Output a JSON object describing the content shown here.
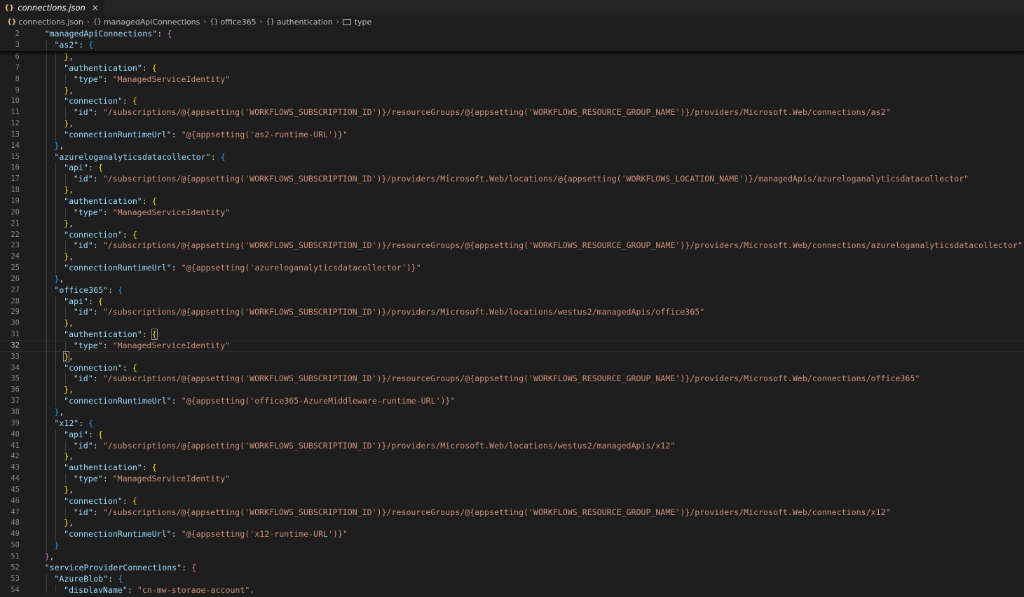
{
  "tab": {
    "icon": "json-braces-icon",
    "icon_text": "{}",
    "label": "connections.json",
    "close": "×"
  },
  "breadcrumb": [
    {
      "icon": "json-braces-icon",
      "icon_text": "{}",
      "label": "connections.json"
    },
    {
      "icon": "object-icon",
      "icon_text": "{}",
      "label": "managedApiConnections"
    },
    {
      "icon": "object-icon",
      "icon_text": "{}",
      "label": "office365"
    },
    {
      "icon": "object-icon",
      "icon_text": "{}",
      "label": "authentication"
    },
    {
      "icon": "string-property-icon",
      "icon_text": "",
      "label": "type"
    }
  ],
  "sticky_lines": [
    {
      "num": "2",
      "indent": 1,
      "tokens": [
        [
          "k",
          "\"managedApiConnections\""
        ],
        [
          "p",
          ": "
        ],
        [
          "b2",
          "{"
        ]
      ]
    },
    {
      "num": "3",
      "indent": 2,
      "tokens": [
        [
          "k",
          "\"as2\""
        ],
        [
          "p",
          ": "
        ],
        [
          "b3",
          "{"
        ]
      ]
    }
  ],
  "current_line": "32",
  "lines": [
    {
      "num": "6",
      "indent": 3,
      "tokens": [
        [
          "b1",
          "}"
        ],
        [
          "p",
          ","
        ]
      ]
    },
    {
      "num": "7",
      "indent": 3,
      "tokens": [
        [
          "k",
          "\"authentication\""
        ],
        [
          "p",
          ": "
        ],
        [
          "b1",
          "{"
        ]
      ]
    },
    {
      "num": "8",
      "indent": 4,
      "tokens": [
        [
          "k",
          "\"type\""
        ],
        [
          "p",
          ": "
        ],
        [
          "s",
          "\"ManagedServiceIdentity\""
        ]
      ]
    },
    {
      "num": "9",
      "indent": 3,
      "tokens": [
        [
          "b1",
          "}"
        ],
        [
          "p",
          ","
        ]
      ]
    },
    {
      "num": "10",
      "indent": 3,
      "tokens": [
        [
          "k",
          "\"connection\""
        ],
        [
          "p",
          ": "
        ],
        [
          "b1",
          "{"
        ]
      ]
    },
    {
      "num": "11",
      "indent": 4,
      "tokens": [
        [
          "k",
          "\"id\""
        ],
        [
          "p",
          ": "
        ],
        [
          "s",
          "\"/subscriptions/@{appsetting('WORKFLOWS_SUBSCRIPTION_ID')}/resourceGroups/@{appsetting('WORKFLOWS_RESOURCE_GROUP_NAME')}/providers/Microsoft.Web/connections/as2\""
        ]
      ]
    },
    {
      "num": "12",
      "indent": 3,
      "tokens": [
        [
          "b1",
          "}"
        ],
        [
          "p",
          ","
        ]
      ]
    },
    {
      "num": "13",
      "indent": 3,
      "tokens": [
        [
          "k",
          "\"connectionRuntimeUrl\""
        ],
        [
          "p",
          ": "
        ],
        [
          "s",
          "\"@{appsetting('as2-runtime-URL')}\""
        ]
      ]
    },
    {
      "num": "14",
      "indent": 2,
      "tokens": [
        [
          "b3",
          "}"
        ],
        [
          "p",
          ","
        ]
      ]
    },
    {
      "num": "15",
      "indent": 2,
      "tokens": [
        [
          "k",
          "\"azureloganalyticsdatacollector\""
        ],
        [
          "p",
          ": "
        ],
        [
          "b3",
          "{"
        ]
      ]
    },
    {
      "num": "16",
      "indent": 3,
      "tokens": [
        [
          "k",
          "\"api\""
        ],
        [
          "p",
          ": "
        ],
        [
          "b1",
          "{"
        ]
      ]
    },
    {
      "num": "17",
      "indent": 4,
      "tokens": [
        [
          "k",
          "\"id\""
        ],
        [
          "p",
          ": "
        ],
        [
          "s",
          "\"/subscriptions/@{appsetting('WORKFLOWS_SUBSCRIPTION_ID')}/providers/Microsoft.Web/locations/@{appsetting('WORKFLOWS_LOCATION_NAME')}/managedApis/azureloganalyticsdatacollector\""
        ]
      ]
    },
    {
      "num": "18",
      "indent": 3,
      "tokens": [
        [
          "b1",
          "}"
        ],
        [
          "p",
          ","
        ]
      ]
    },
    {
      "num": "19",
      "indent": 3,
      "tokens": [
        [
          "k",
          "\"authentication\""
        ],
        [
          "p",
          ": "
        ],
        [
          "b1",
          "{"
        ]
      ]
    },
    {
      "num": "20",
      "indent": 4,
      "tokens": [
        [
          "k",
          "\"type\""
        ],
        [
          "p",
          ": "
        ],
        [
          "s",
          "\"ManagedServiceIdentity\""
        ]
      ]
    },
    {
      "num": "21",
      "indent": 3,
      "tokens": [
        [
          "b1",
          "}"
        ],
        [
          "p",
          ","
        ]
      ]
    },
    {
      "num": "22",
      "indent": 3,
      "tokens": [
        [
          "k",
          "\"connection\""
        ],
        [
          "p",
          ": "
        ],
        [
          "b1",
          "{"
        ]
      ]
    },
    {
      "num": "23",
      "indent": 4,
      "tokens": [
        [
          "k",
          "\"id\""
        ],
        [
          "p",
          ": "
        ],
        [
          "s",
          "\"/subscriptions/@{appsetting('WORKFLOWS_SUBSCRIPTION_ID')}/resourceGroups/@{appsetting('WORKFLOWS_RESOURCE_GROUP_NAME')}/providers/Microsoft.Web/connections/azureloganalyticsdatacollector\""
        ]
      ]
    },
    {
      "num": "24",
      "indent": 3,
      "tokens": [
        [
          "b1",
          "}"
        ],
        [
          "p",
          ","
        ]
      ]
    },
    {
      "num": "25",
      "indent": 3,
      "tokens": [
        [
          "k",
          "\"connectionRuntimeUrl\""
        ],
        [
          "p",
          ": "
        ],
        [
          "s",
          "\"@{appsetting('azureloganalyticsdatacollector')}\""
        ]
      ]
    },
    {
      "num": "26",
      "indent": 2,
      "tokens": [
        [
          "b3",
          "}"
        ],
        [
          "p",
          ","
        ]
      ]
    },
    {
      "num": "27",
      "indent": 2,
      "tokens": [
        [
          "k",
          "\"office365\""
        ],
        [
          "p",
          ": "
        ],
        [
          "b3",
          "{"
        ]
      ]
    },
    {
      "num": "28",
      "indent": 3,
      "tokens": [
        [
          "k",
          "\"api\""
        ],
        [
          "p",
          ": "
        ],
        [
          "b1",
          "{"
        ]
      ]
    },
    {
      "num": "29",
      "indent": 4,
      "tokens": [
        [
          "k",
          "\"id\""
        ],
        [
          "p",
          ": "
        ],
        [
          "s",
          "\"/subscriptions/@{appsetting('WORKFLOWS_SUBSCRIPTION_ID')}/providers/Microsoft.Web/locations/westus2/managedApis/office365\""
        ]
      ]
    },
    {
      "num": "30",
      "indent": 3,
      "tokens": [
        [
          "b1",
          "}"
        ],
        [
          "p",
          ","
        ]
      ]
    },
    {
      "num": "31",
      "indent": 3,
      "tokens": [
        [
          "k",
          "\"authentication\""
        ],
        [
          "p",
          ": "
        ],
        [
          "b1h",
          "{"
        ]
      ]
    },
    {
      "num": "32",
      "indent": 4,
      "tokens": [
        [
          "k",
          "\"type\""
        ],
        [
          "p",
          ": "
        ],
        [
          "s",
          "\"ManagedServiceIdentity\""
        ]
      ]
    },
    {
      "num": "33",
      "indent": 3,
      "tokens": [
        [
          "b1h",
          "}"
        ],
        [
          "p",
          ","
        ]
      ]
    },
    {
      "num": "34",
      "indent": 3,
      "tokens": [
        [
          "k",
          "\"connection\""
        ],
        [
          "p",
          ": "
        ],
        [
          "b1",
          "{"
        ]
      ]
    },
    {
      "num": "35",
      "indent": 4,
      "tokens": [
        [
          "k",
          "\"id\""
        ],
        [
          "p",
          ": "
        ],
        [
          "s",
          "\"/subscriptions/@{appsetting('WORKFLOWS_SUBSCRIPTION_ID')}/resourceGroups/@{appsetting('WORKFLOWS_RESOURCE_GROUP_NAME')}/providers/Microsoft.Web/connections/office365\""
        ]
      ]
    },
    {
      "num": "36",
      "indent": 3,
      "tokens": [
        [
          "b1",
          "}"
        ],
        [
          "p",
          ","
        ]
      ]
    },
    {
      "num": "37",
      "indent": 3,
      "tokens": [
        [
          "k",
          "\"connectionRuntimeUrl\""
        ],
        [
          "p",
          ": "
        ],
        [
          "s",
          "\"@{appsetting('office365-AzureMiddleware-runtime-URL')}\""
        ]
      ]
    },
    {
      "num": "38",
      "indent": 2,
      "tokens": [
        [
          "b3",
          "}"
        ],
        [
          "p",
          ","
        ]
      ]
    },
    {
      "num": "39",
      "indent": 2,
      "tokens": [
        [
          "k",
          "\"x12\""
        ],
        [
          "p",
          ": "
        ],
        [
          "b3",
          "{"
        ]
      ]
    },
    {
      "num": "40",
      "indent": 3,
      "tokens": [
        [
          "k",
          "\"api\""
        ],
        [
          "p",
          ": "
        ],
        [
          "b1",
          "{"
        ]
      ]
    },
    {
      "num": "41",
      "indent": 4,
      "tokens": [
        [
          "k",
          "\"id\""
        ],
        [
          "p",
          ": "
        ],
        [
          "s",
          "\"/subscriptions/@{appsetting('WORKFLOWS_SUBSCRIPTION_ID')}/providers/Microsoft.Web/locations/westus2/managedApis/x12\""
        ]
      ]
    },
    {
      "num": "42",
      "indent": 3,
      "tokens": [
        [
          "b1",
          "}"
        ],
        [
          "p",
          ","
        ]
      ]
    },
    {
      "num": "43",
      "indent": 3,
      "tokens": [
        [
          "k",
          "\"authentication\""
        ],
        [
          "p",
          ": "
        ],
        [
          "b1",
          "{"
        ]
      ]
    },
    {
      "num": "44",
      "indent": 4,
      "tokens": [
        [
          "k",
          "\"type\""
        ],
        [
          "p",
          ": "
        ],
        [
          "s",
          "\"ManagedServiceIdentity\""
        ]
      ]
    },
    {
      "num": "45",
      "indent": 3,
      "tokens": [
        [
          "b1",
          "}"
        ],
        [
          "p",
          ","
        ]
      ]
    },
    {
      "num": "46",
      "indent": 3,
      "tokens": [
        [
          "k",
          "\"connection\""
        ],
        [
          "p",
          ": "
        ],
        [
          "b1",
          "{"
        ]
      ]
    },
    {
      "num": "47",
      "indent": 4,
      "tokens": [
        [
          "k",
          "\"id\""
        ],
        [
          "p",
          ": "
        ],
        [
          "s",
          "\"/subscriptions/@{appsetting('WORKFLOWS_SUBSCRIPTION_ID')}/resourceGroups/@{appsetting('WORKFLOWS_RESOURCE_GROUP_NAME')}/providers/Microsoft.Web/connections/x12\""
        ]
      ]
    },
    {
      "num": "48",
      "indent": 3,
      "tokens": [
        [
          "b1",
          "}"
        ],
        [
          "p",
          ","
        ]
      ]
    },
    {
      "num": "49",
      "indent": 3,
      "tokens": [
        [
          "k",
          "\"connectionRuntimeUrl\""
        ],
        [
          "p",
          ": "
        ],
        [
          "s",
          "\"@{appsetting('x12-runtime-URL')}\""
        ]
      ]
    },
    {
      "num": "50",
      "indent": 2,
      "tokens": [
        [
          "b3",
          "}"
        ]
      ]
    },
    {
      "num": "51",
      "indent": 1,
      "tokens": [
        [
          "b2",
          "}"
        ],
        [
          "p",
          ","
        ]
      ]
    },
    {
      "num": "52",
      "indent": 1,
      "tokens": [
        [
          "k",
          "\"serviceProviderConnections\""
        ],
        [
          "p",
          ": "
        ],
        [
          "b2",
          "{"
        ]
      ]
    },
    {
      "num": "53",
      "indent": 2,
      "tokens": [
        [
          "k",
          "\"AzureBlob\""
        ],
        [
          "p",
          ": "
        ],
        [
          "b3",
          "{"
        ]
      ]
    },
    {
      "num": "54",
      "indent": 3,
      "tokens": [
        [
          "k",
          "\"displayName\""
        ],
        [
          "p",
          ": "
        ],
        [
          "s",
          "\"cn-mw-storage-account\""
        ],
        [
          "p",
          ","
        ]
      ]
    }
  ]
}
